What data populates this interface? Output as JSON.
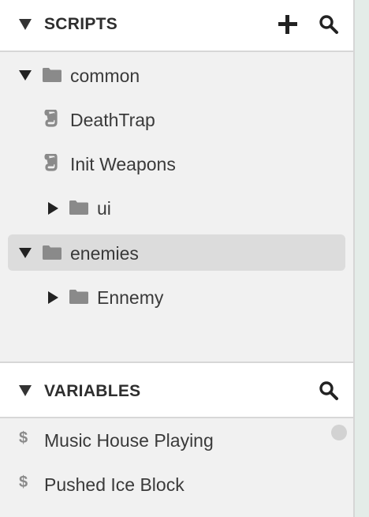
{
  "scripts": {
    "title": "SCRIPTS",
    "tree": [
      {
        "label": "common",
        "kind": "folder",
        "expanded": true
      },
      {
        "label": "DeathTrap",
        "kind": "script"
      },
      {
        "label": "Init Weapons",
        "kind": "script"
      },
      {
        "label": "ui",
        "kind": "folder",
        "expanded": false
      },
      {
        "label": "enemies",
        "kind": "folder",
        "expanded": true,
        "selected": true
      },
      {
        "label": "Ennemy",
        "kind": "folder",
        "expanded": false
      }
    ]
  },
  "variables": {
    "title": "VARIABLES",
    "symbol": "$",
    "items": [
      {
        "label": "Music House Playing"
      },
      {
        "label": "Pushed Ice Block"
      }
    ]
  },
  "colors": {
    "panel_bg": "#f1f1f1",
    "header_bg": "#ffffff",
    "selected_bg": "#dcdcdc",
    "icon_gray": "#8a8a8a"
  }
}
